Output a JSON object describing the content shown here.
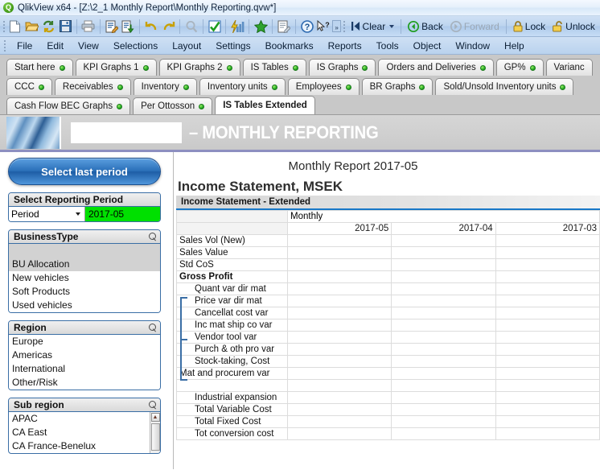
{
  "window": {
    "app_name": "QlikView x64",
    "title": "QlikView x64 - [Z:\\2_1 Monthly Report\\Monthly Reporting.qvw*]",
    "logo_letter": "Q"
  },
  "toolbar": {
    "icons": [
      {
        "name": "new-document-icon",
        "glyph": "⬜"
      },
      {
        "name": "open-folder-icon",
        "glyph": "📂"
      },
      {
        "name": "reload-icon",
        "glyph": "↻"
      },
      {
        "name": "save-icon",
        "glyph": "💾"
      },
      {
        "name": "print-icon",
        "glyph": "🖨"
      },
      {
        "name": "edit-script-icon",
        "glyph": "📝"
      },
      {
        "name": "export-icon",
        "glyph": "⬇"
      },
      {
        "name": "undo-icon",
        "glyph": "↶"
      },
      {
        "name": "redo-icon",
        "glyph": "↷"
      },
      {
        "name": "search-icon",
        "glyph": "🔍"
      },
      {
        "name": "select-check-icon",
        "glyph": "✔"
      },
      {
        "name": "quick-chart-icon",
        "glyph": "📊"
      },
      {
        "name": "favorite-star-icon",
        "glyph": "★"
      },
      {
        "name": "notes-icon",
        "glyph": "📃"
      },
      {
        "name": "help-icon",
        "glyph": "?"
      },
      {
        "name": "context-help-icon",
        "glyph": "↖"
      }
    ],
    "clear_label": "Clear",
    "back_label": "Back",
    "forward_label": "Forward",
    "lock_label": "Lock",
    "unlock_label": "Unlock",
    "overflow_label": "»"
  },
  "menu": {
    "items": [
      "File",
      "Edit",
      "View",
      "Selections",
      "Layout",
      "Settings",
      "Bookmarks",
      "Reports",
      "Tools",
      "Object",
      "Window",
      "Help"
    ]
  },
  "tabs": {
    "row1": [
      {
        "label": "Start here",
        "active": false
      },
      {
        "label": "KPI Graphs 1",
        "active": false
      },
      {
        "label": "KPI Graphs 2",
        "active": false
      },
      {
        "label": "IS Tables",
        "active": false
      },
      {
        "label": "IS Graphs",
        "active": false
      },
      {
        "label": "Orders and Deliveries",
        "active": false
      },
      {
        "label": "GP%",
        "active": false
      },
      {
        "label": "Varianc",
        "active": false
      }
    ],
    "row2": [
      {
        "label": "CCC",
        "active": false
      },
      {
        "label": "Receivables",
        "active": false
      },
      {
        "label": "Inventory",
        "active": false
      },
      {
        "label": "Inventory units",
        "active": false
      },
      {
        "label": "Employees",
        "active": false
      },
      {
        "label": "BR Graphs",
        "active": false
      },
      {
        "label": "Sold/Unsold Inventory units",
        "active": false
      }
    ],
    "row3": [
      {
        "label": "Cash Flow BEC Graphs",
        "active": false
      },
      {
        "label": "Per Ottosson",
        "active": false
      },
      {
        "label": "IS Tables Extended",
        "active": true
      }
    ]
  },
  "banner": {
    "title": "– MONTHLY REPORTING"
  },
  "sidebar": {
    "select_last_period_label": "Select last period",
    "reporting_period": {
      "caption": "Select Reporting Period",
      "field_label": "Period",
      "value": "2017-05",
      "value_color": "#00e000"
    },
    "business_type": {
      "caption": "BusinessType",
      "items": [
        "",
        "BU Allocation",
        "New vehicles",
        "Soft Products",
        "Used vehicles"
      ],
      "selected_index": 1
    },
    "region": {
      "caption": "Region",
      "items": [
        "Europe",
        "Americas",
        "International",
        "Other/Risk"
      ]
    },
    "sub_region": {
      "caption": "Sub region",
      "items": [
        "APAC",
        "CA East",
        "CA France-Benelux"
      ]
    }
  },
  "main": {
    "report_title": "Monthly Report 2017-05",
    "income_statement_title": "Income Statement, MSEK",
    "income_statement_subtitle": "Income Statement - Extended",
    "table": {
      "group_header": "Monthly",
      "columns": [
        "2017-05",
        "2017-04",
        "2017-03"
      ],
      "rows": [
        {
          "label": "Sales Vol (New)",
          "style": "normal",
          "values": [
            "",
            "",
            ""
          ]
        },
        {
          "label": "Sales Value",
          "style": "normal",
          "values": [
            "",
            "",
            ""
          ]
        },
        {
          "label": "Std CoS",
          "style": "normal",
          "values": [
            "",
            "",
            ""
          ]
        },
        {
          "label": "Gross Profit",
          "style": "bold",
          "values": [
            "",
            "",
            ""
          ]
        },
        {
          "label": "Quant var dir mat",
          "style": "indent",
          "values": [
            "",
            "",
            ""
          ]
        },
        {
          "label": "Price var dir mat",
          "style": "indent",
          "values": [
            "",
            "",
            ""
          ]
        },
        {
          "label": "Cancellat cost var",
          "style": "indent",
          "values": [
            "",
            "",
            ""
          ]
        },
        {
          "label": "Inc mat ship co var",
          "style": "indent",
          "values": [
            "",
            "",
            ""
          ]
        },
        {
          "label": "Vendor tool var",
          "style": "indent",
          "values": [
            "",
            "",
            ""
          ]
        },
        {
          "label": "Purch & oth pro var",
          "style": "indent",
          "values": [
            "",
            "",
            ""
          ]
        },
        {
          "label": "Stock-taking, Cost",
          "style": "indent",
          "values": [
            "",
            "",
            ""
          ]
        },
        {
          "label": "Mat and procurem var",
          "style": "normal",
          "values": [
            "",
            "",
            ""
          ]
        },
        {
          "label": "",
          "style": "normal",
          "values": [
            "",
            "",
            ""
          ]
        },
        {
          "label": "Industrial expansion",
          "style": "indent",
          "values": [
            "",
            "",
            ""
          ]
        },
        {
          "label": "Total Variable Cost",
          "style": "indent",
          "values": [
            "",
            "",
            ""
          ]
        },
        {
          "label": "Total Fixed Cost",
          "style": "indent",
          "values": [
            "",
            "",
            ""
          ]
        },
        {
          "label": "Tot conversion cost",
          "style": "indent",
          "values": [
            "",
            "",
            ""
          ]
        }
      ]
    }
  }
}
